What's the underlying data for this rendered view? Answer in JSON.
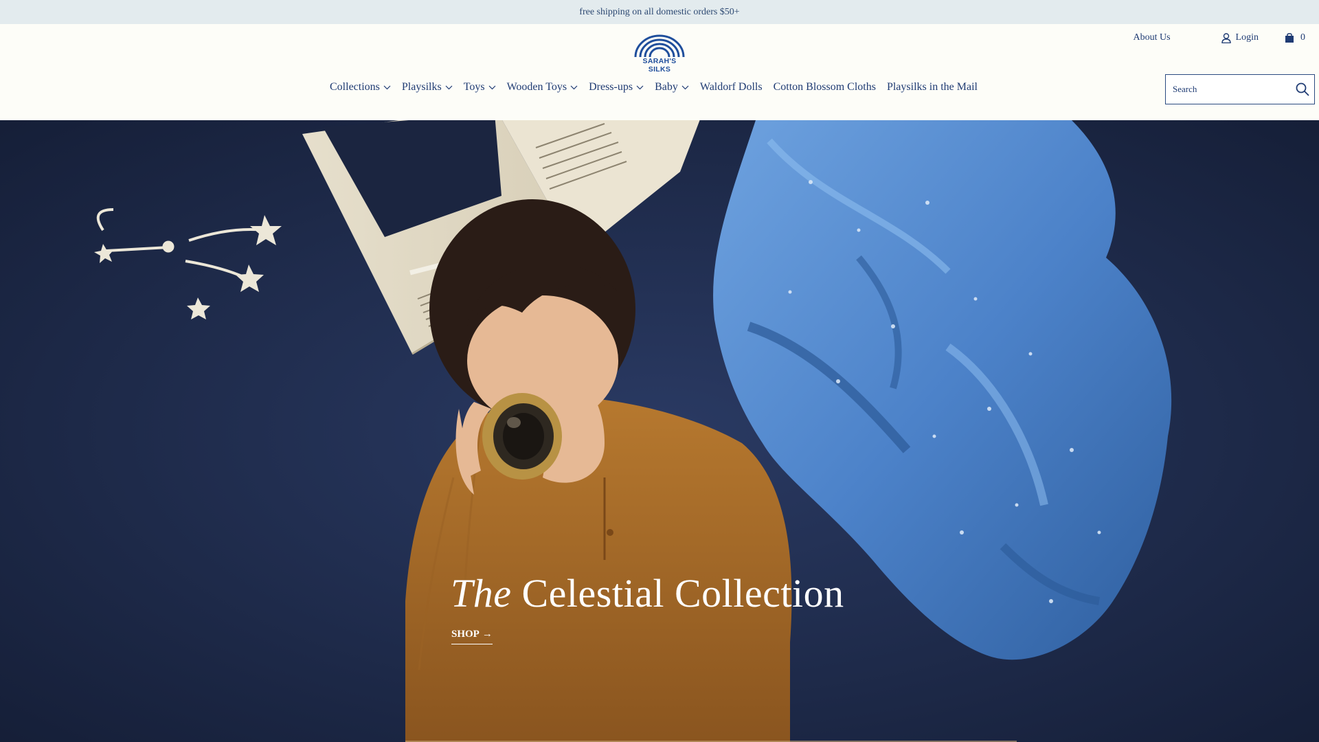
{
  "announcement": {
    "text": "free shipping on all domestic orders $50+"
  },
  "header": {
    "logo_text": "SARAH'S SILKS",
    "about_label": "About Us",
    "login_label": "Login",
    "cart_count": "0"
  },
  "nav": {
    "items": [
      {
        "label": "Collections",
        "has_dropdown": true
      },
      {
        "label": "Playsilks",
        "has_dropdown": true
      },
      {
        "label": "Toys",
        "has_dropdown": true
      },
      {
        "label": "Wooden Toys",
        "has_dropdown": true
      },
      {
        "label": "Dress-ups",
        "has_dropdown": true
      },
      {
        "label": "Baby",
        "has_dropdown": true
      },
      {
        "label": "Waldorf Dolls",
        "has_dropdown": false
      },
      {
        "label": "Cotton Blossom Cloths",
        "has_dropdown": false
      },
      {
        "label": "Playsilks in the Mail",
        "has_dropdown": false
      }
    ]
  },
  "search": {
    "placeholder": "Search",
    "icon": "search-icon"
  },
  "hero": {
    "title_prefix": "The",
    "title_main": "Celestial Collection",
    "cta_label": "SHOP",
    "cta_arrow": "→"
  },
  "colors": {
    "brand": "#1f3b73",
    "announcement_bg": "#e3ebee",
    "hero_bg": "#1f2a47",
    "silk": "#4f86cc",
    "sweater": "#a96a2b"
  }
}
